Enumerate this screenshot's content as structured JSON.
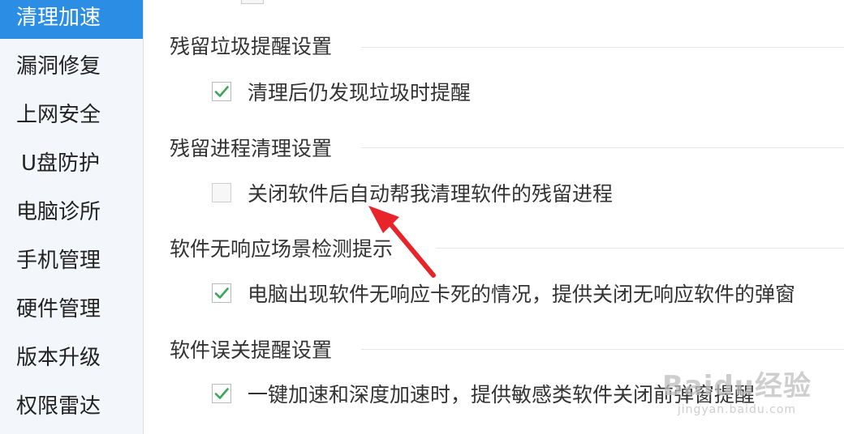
{
  "sidebar": {
    "items": [
      {
        "label": "清理加速",
        "active": true
      },
      {
        "label": "漏洞修复",
        "active": false
      },
      {
        "label": "上网安全",
        "active": false
      },
      {
        "label": "U盘防护",
        "active": false
      },
      {
        "label": "电脑诊所",
        "active": false
      },
      {
        "label": "手机管理",
        "active": false
      },
      {
        "label": "硬件管理",
        "active": false
      },
      {
        "label": "版本升级",
        "active": false
      },
      {
        "label": "权限雷达",
        "active": false
      }
    ]
  },
  "sections": [
    {
      "title": "残留垃圾提醒设置",
      "option": {
        "label": "清理后仍发现垃圾时提醒",
        "checked": true
      }
    },
    {
      "title": "残留进程清理设置",
      "option": {
        "label": "关闭软件后自动帮我清理软件的残留进程",
        "checked": false
      }
    },
    {
      "title": "软件无响应场景检测提示",
      "option": {
        "label": "电脑出现软件无响应卡死的情况，提供关闭无响应软件的弹窗",
        "checked": true
      }
    },
    {
      "title": "软件误关提醒设置",
      "option": {
        "label": "一键加速和深度加速时，提供敏感类软件关闭前弹窗提醒",
        "checked": true
      }
    }
  ],
  "colors": {
    "accent": "#2b8de3",
    "check": "#3aa757",
    "arrow": "#e8232a"
  },
  "watermark": {
    "main": "Baidu经验",
    "sub": "jingyan.baidu.com"
  }
}
